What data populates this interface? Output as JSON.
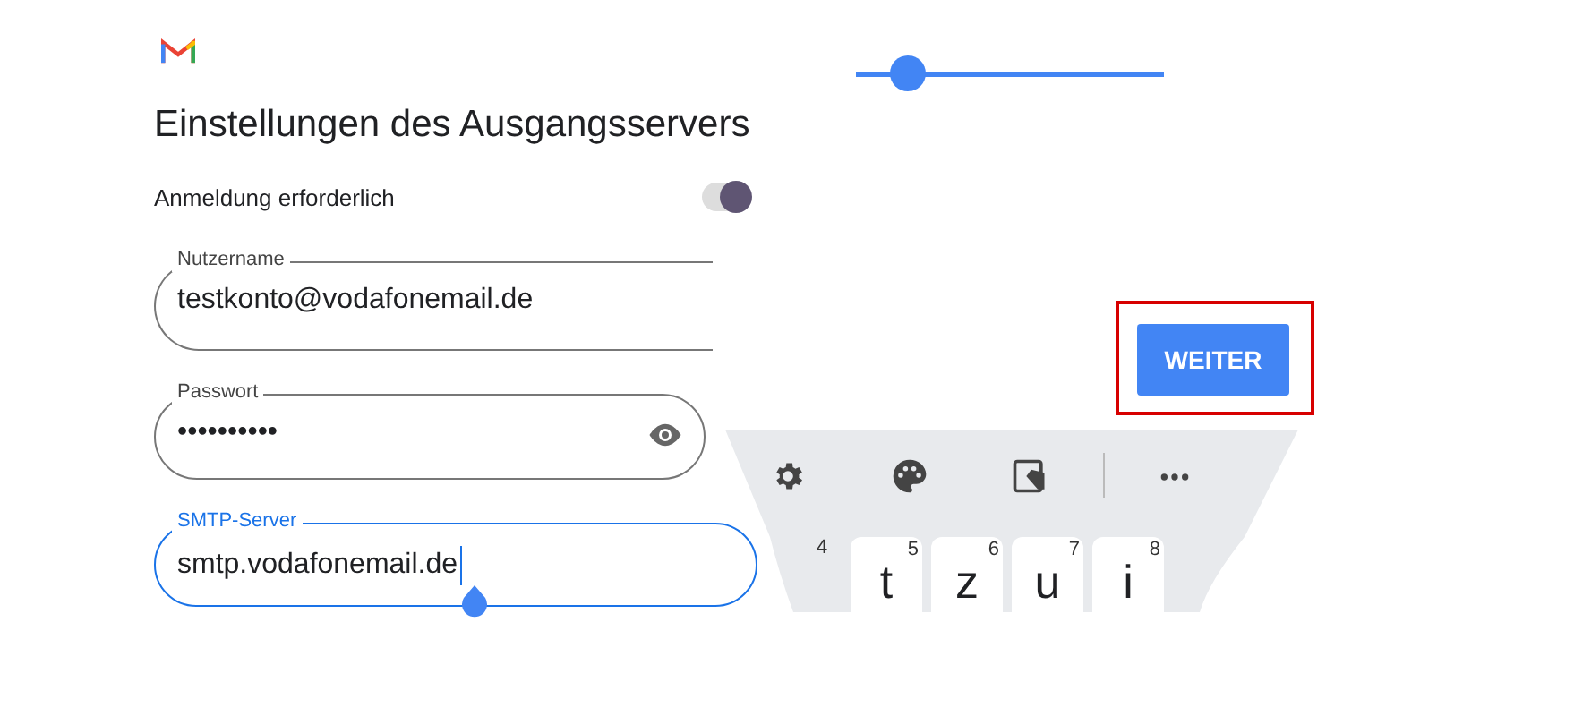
{
  "title": "Einstellungen des Ausgangsservers",
  "login_toggle": {
    "label": "Anmeldung erforderlich",
    "on": true
  },
  "fields": [
    {
      "kind": "text",
      "label": "Nutzername",
      "value": "testkonto@vodafonemail.de",
      "focused": false
    },
    {
      "kind": "password",
      "label": "Passwort",
      "value": "••••••••••",
      "focused": false
    },
    {
      "kind": "text",
      "label": "SMTP-Server",
      "value": "smtp.vodafonemail.de",
      "focused": true
    }
  ],
  "slider": {
    "level": 0.17
  },
  "next_button": {
    "label": "WEITER",
    "highlighted": true
  },
  "keyboard": {
    "keys": [
      {
        "hint": "4"
      },
      {
        "label": "t",
        "hint": "5"
      },
      {
        "label": "z",
        "hint": "6"
      },
      {
        "label": "u",
        "hint": "7"
      },
      {
        "label": "i",
        "hint": "8"
      }
    ]
  }
}
